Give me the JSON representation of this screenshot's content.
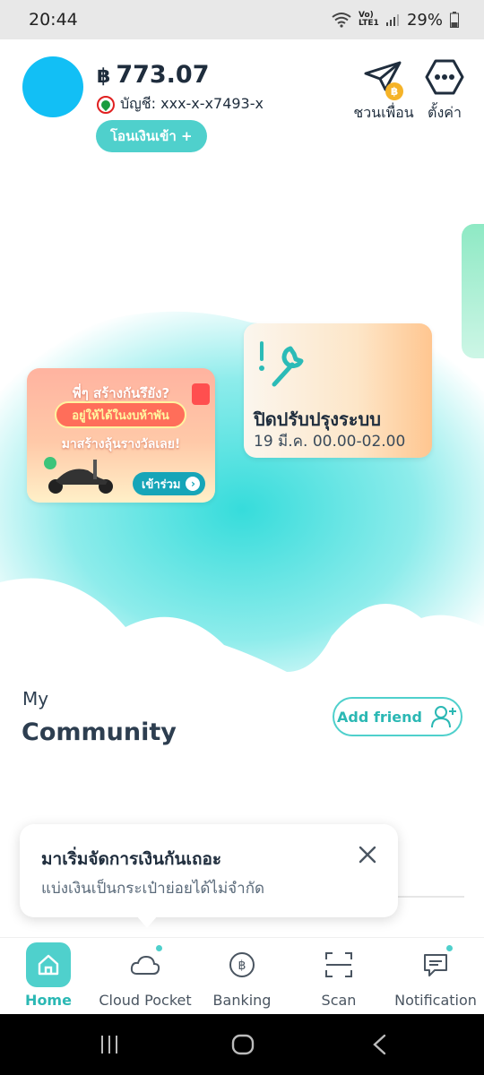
{
  "status_bar": {
    "time": "20:44",
    "network": "Vo) LTE1",
    "battery": "29%"
  },
  "header": {
    "currency_symbol": "฿",
    "balance": "773.07",
    "account_label": "บัญชี: xxx-x-x7493-x",
    "transfer_in_label": "โอนเงินเข้า +",
    "invite_label": "ชวนเพื่อน",
    "settings_label": "ตั้งค่า",
    "invite_badge": "฿"
  },
  "cards": {
    "promo": {
      "title": "พี่ๆ สร้างกันรึยัง?",
      "pill": "อยู่ให้ได้ในงบห้าพัน",
      "subtitle": "มาสร้างลุ้นรางวัลเลย!",
      "join_label": "เข้าร่วม"
    },
    "maintenance": {
      "title": "ปิดปรับปรุงระบบ",
      "time": "19 มี.ค. 00.00-02.00"
    }
  },
  "community": {
    "my_label": "My",
    "title": "Community",
    "add_friend_label": "Add friend"
  },
  "tooltip": {
    "title": "มาเริ่มจัดการเงินกันเถอะ",
    "subtitle": "แบ่งเงินเป็นกระเป๋าย่อยได้ไม่จำกัด"
  },
  "bottom_nav": {
    "items": [
      {
        "label": "Home",
        "icon": "home-icon",
        "active": true
      },
      {
        "label": "Cloud Pocket",
        "icon": "cloud-icon",
        "badge": true
      },
      {
        "label": "Banking",
        "icon": "baht-icon"
      },
      {
        "label": "Scan",
        "icon": "scan-icon"
      },
      {
        "label": "Notification",
        "icon": "chat-icon",
        "badge": true
      }
    ]
  },
  "colors": {
    "accent": "#4fd0cc",
    "accent_text": "#2bb8b4",
    "avatar": "#12bff5",
    "text": "#1f2d3d"
  }
}
